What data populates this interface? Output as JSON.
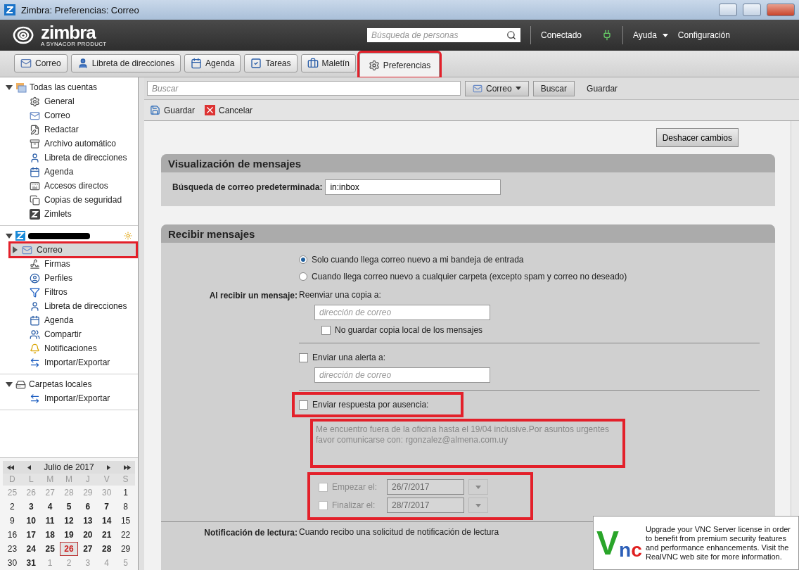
{
  "window": {
    "title": "Zimbra: Preferencias: Correo"
  },
  "header": {
    "logo": "zimbra",
    "logo_tagline": "A SYNACOR PRODUCT",
    "people_search": {
      "placeholder": "Búsqueda de personas"
    },
    "status": "Conectado",
    "help": "Ayuda",
    "settings": "Configuración"
  },
  "tabs": [
    {
      "label": "Correo",
      "selected": false,
      "annotated": false
    },
    {
      "label": "Libreta de direcciones",
      "selected": false,
      "annotated": false
    },
    {
      "label": "Agenda",
      "selected": false,
      "annotated": false
    },
    {
      "label": "Tareas",
      "selected": false,
      "annotated": false
    },
    {
      "label": "Maletín",
      "selected": false,
      "annotated": false
    },
    {
      "label": "Preferencias",
      "selected": true,
      "annotated": true
    }
  ],
  "sidebar": {
    "groups": [
      {
        "kind": "folder",
        "label": "Todas las cuentas",
        "expanded": true,
        "children": [
          {
            "label": "General",
            "selected": false,
            "annotated": false
          },
          {
            "label": "Correo",
            "selected": false,
            "annotated": false
          },
          {
            "label": "Redactar",
            "selected": false,
            "annotated": false
          },
          {
            "label": "Archivo automático",
            "selected": false,
            "annotated": false
          },
          {
            "label": "Libreta de direcciones",
            "selected": false,
            "annotated": false
          },
          {
            "label": "Agenda",
            "selected": false,
            "annotated": false
          },
          {
            "label": "Accesos directos",
            "selected": false,
            "annotated": false
          },
          {
            "label": "Copias de seguridad",
            "selected": false,
            "annotated": false
          },
          {
            "label": "Zimlets",
            "selected": false,
            "annotated": false
          }
        ]
      },
      {
        "kind": "account",
        "expanded": true,
        "children": [
          {
            "label": "Correo",
            "selected": true,
            "annotated": true
          },
          {
            "label": "Firmas",
            "selected": false,
            "annotated": false
          },
          {
            "label": "Perfiles",
            "selected": false,
            "annotated": false
          },
          {
            "label": "Filtros",
            "selected": false,
            "annotated": false
          },
          {
            "label": "Libreta de direcciones",
            "selected": false,
            "annotated": false
          },
          {
            "label": "Agenda",
            "selected": false,
            "annotated": false
          },
          {
            "label": "Compartir",
            "selected": false,
            "annotated": false
          },
          {
            "label": "Notificaciones",
            "selected": false,
            "annotated": false
          },
          {
            "label": "Importar/Exportar",
            "selected": false,
            "annotated": false
          }
        ]
      },
      {
        "kind": "local",
        "label": "Carpetas locales",
        "expanded": true,
        "children": [
          {
            "label": "Importar/Exportar",
            "selected": false,
            "annotated": false
          }
        ]
      }
    ]
  },
  "calendar": {
    "month": "Julio de 2017",
    "weekdays": [
      "D",
      "L",
      "M",
      "M",
      "J",
      "V",
      "S"
    ],
    "days": [
      {
        "day": "25",
        "other_month": true,
        "selected": false
      },
      {
        "day": "26",
        "other_month": true,
        "selected": false
      },
      {
        "day": "27",
        "other_month": true,
        "selected": false
      },
      {
        "day": "28",
        "other_month": true,
        "selected": false
      },
      {
        "day": "29",
        "other_month": true,
        "selected": false
      },
      {
        "day": "30",
        "other_month": true,
        "selected": false
      },
      {
        "day": "1",
        "other_month": false,
        "selected": false
      },
      {
        "day": "2",
        "other_month": false,
        "selected": false
      },
      {
        "day": "3",
        "other_month": false,
        "selected": false
      },
      {
        "day": "4",
        "other_month": false,
        "selected": false
      },
      {
        "day": "5",
        "other_month": false,
        "selected": false
      },
      {
        "day": "6",
        "other_month": false,
        "selected": false
      },
      {
        "day": "7",
        "other_month": false,
        "selected": false
      },
      {
        "day": "8",
        "other_month": false,
        "selected": false
      },
      {
        "day": "9",
        "other_month": false,
        "selected": false
      },
      {
        "day": "10",
        "other_month": false,
        "selected": false
      },
      {
        "day": "11",
        "other_month": false,
        "selected": false
      },
      {
        "day": "12",
        "other_month": false,
        "selected": false
      },
      {
        "day": "13",
        "other_month": false,
        "selected": false
      },
      {
        "day": "14",
        "other_month": false,
        "selected": false
      },
      {
        "day": "15",
        "other_month": false,
        "selected": false
      },
      {
        "day": "16",
        "other_month": false,
        "selected": false
      },
      {
        "day": "17",
        "other_month": false,
        "selected": false
      },
      {
        "day": "18",
        "other_month": false,
        "selected": false
      },
      {
        "day": "19",
        "other_month": false,
        "selected": false
      },
      {
        "day": "20",
        "other_month": false,
        "selected": false
      },
      {
        "day": "21",
        "other_month": false,
        "selected": false
      },
      {
        "day": "22",
        "other_month": false,
        "selected": false
      },
      {
        "day": "23",
        "other_month": false,
        "selected": false
      },
      {
        "day": "24",
        "other_month": false,
        "selected": false
      },
      {
        "day": "25",
        "other_month": false,
        "selected": false
      },
      {
        "day": "26",
        "other_month": false,
        "selected": true
      },
      {
        "day": "27",
        "other_month": false,
        "selected": false
      },
      {
        "day": "28",
        "other_month": false,
        "selected": false
      },
      {
        "day": "29",
        "other_month": false,
        "selected": false
      },
      {
        "day": "30",
        "other_month": false,
        "selected": false
      },
      {
        "day": "31",
        "other_month": false,
        "selected": false
      },
      {
        "day": "1",
        "other_month": true,
        "selected": false
      },
      {
        "day": "2",
        "other_month": true,
        "selected": false
      },
      {
        "day": "3",
        "other_month": true,
        "selected": false
      },
      {
        "day": "4",
        "other_month": true,
        "selected": false
      },
      {
        "day": "5",
        "other_month": true,
        "selected": false
      }
    ]
  },
  "search_bar": {
    "placeholder": "Buscar",
    "scope": "Correo",
    "search_button": "Buscar",
    "save_button": "Guardar"
  },
  "actions": {
    "save": "Guardar",
    "cancel": "Cancelar"
  },
  "undo_button": "Deshacer cambios",
  "display_section": {
    "title": "Visualización de mensajes",
    "label": "Búsqueda de correo predeterminada:",
    "value": "in:inbox"
  },
  "receive_section": {
    "title": "Recibir mensajes",
    "radios": [
      {
        "label": "Solo cuando llega correo nuevo a mi bandeja de entrada",
        "selected": true
      },
      {
        "label": "Cuando llega correo nuevo a cualquier carpeta (excepto spam y correo no deseado)",
        "selected": false
      }
    ],
    "on_receive_label": "Al recibir un mensaje:",
    "forward_label": "Reenviar una copia a:",
    "forward_placeholder": "dirección de correo",
    "no_local_copy": {
      "label": "No guardar copia local de los mensajes",
      "checked": false
    },
    "alert": {
      "label": "Enviar una alerta a:",
      "checked": false,
      "placeholder": "dirección de correo"
    },
    "away": {
      "label": "Enviar respuesta por ausencia:",
      "checked": false,
      "annotated": true,
      "message": "Me encuentro fuera de la oficina hasta el 19/04 inclusive.Por asuntos urgentes favor comunicarse con: rgonzalez@almena.com.uy",
      "message_annotated": true,
      "dates_annotated": true,
      "dates": [
        {
          "label": "Empezar el:",
          "checked": false,
          "value": "26/7/2017"
        },
        {
          "label": "Finalizar el:",
          "checked": false,
          "value": "28/7/2017"
        }
      ]
    },
    "read_receipt_label": "Notificación de lectura:",
    "read_receipt_text": "Cuando recibo una solicitud de notificación de lectura"
  },
  "vnc_notice": {
    "logo": [
      "V",
      "n",
      "c"
    ],
    "text": "Upgrade your VNC Server license in order to benefit from premium security features and performance enhancements. Visit the RealVNC web site for more information."
  }
}
